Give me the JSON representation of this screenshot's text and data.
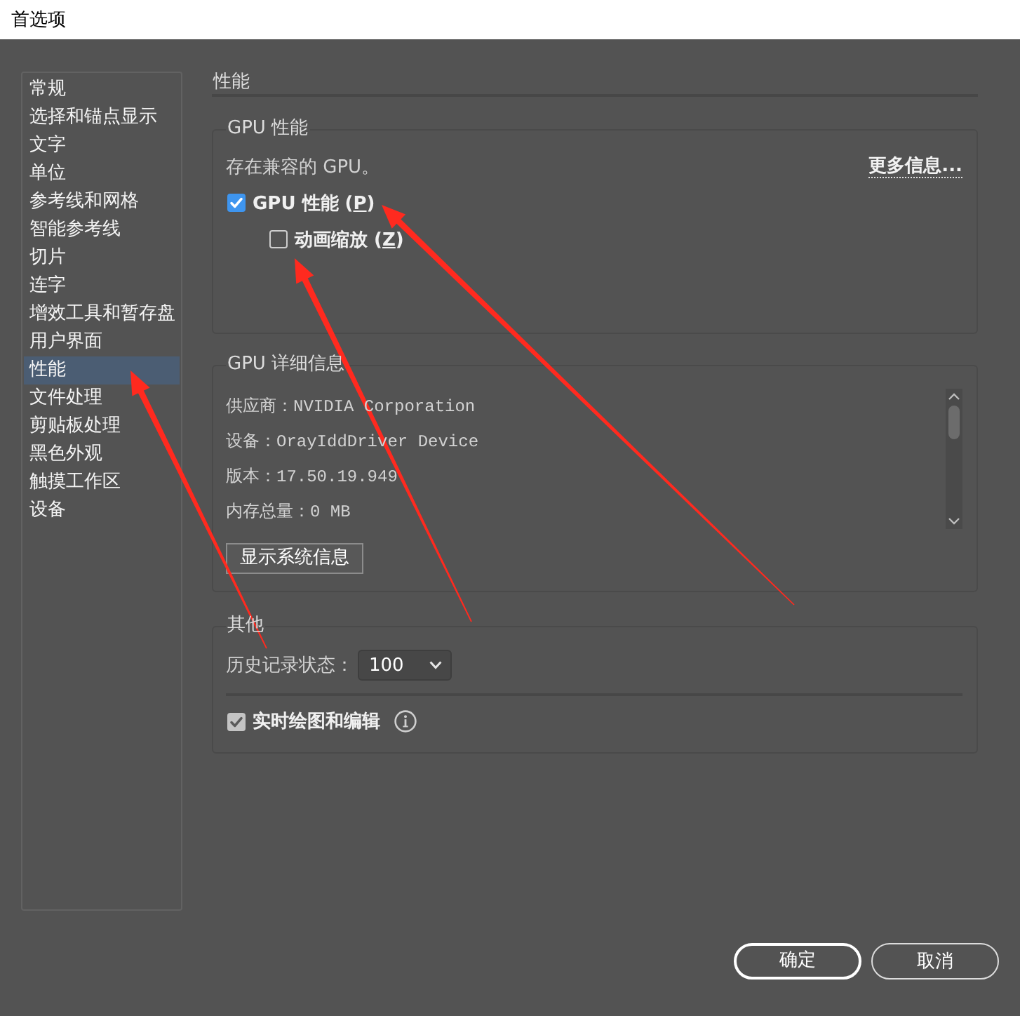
{
  "window": {
    "title": "首选项"
  },
  "sidebar": {
    "items": [
      {
        "label": "常规",
        "selected": false
      },
      {
        "label": "选择和锚点显示",
        "selected": false
      },
      {
        "label": "文字",
        "selected": false
      },
      {
        "label": "单位",
        "selected": false
      },
      {
        "label": "参考线和网格",
        "selected": false
      },
      {
        "label": "智能参考线",
        "selected": false
      },
      {
        "label": "切片",
        "selected": false
      },
      {
        "label": "连字",
        "selected": false
      },
      {
        "label": "增效工具和暂存盘",
        "selected": false
      },
      {
        "label": "用户界面",
        "selected": false
      },
      {
        "label": "性能",
        "selected": true
      },
      {
        "label": "文件处理",
        "selected": false
      },
      {
        "label": "剪贴板处理",
        "selected": false
      },
      {
        "label": "黑色外观",
        "selected": false
      },
      {
        "label": "触摸工作区",
        "selected": false
      },
      {
        "label": "设备",
        "selected": false
      }
    ]
  },
  "panel": {
    "heading": "性能",
    "gpu_performance": {
      "title": "GPU 性能",
      "status": "存在兼容的 GPU。",
      "more_info_link": "更多信息...",
      "checkboxes": [
        {
          "label_parts": [
            {
              "text": "GPU 性能 (",
              "underlined": false
            },
            {
              "text": "P",
              "underlined": true
            },
            {
              "text": ")",
              "underlined": false
            }
          ],
          "checked": true,
          "focused": true,
          "children": [
            {
              "label_parts": [
                {
                  "text": "动画缩放 (",
                  "underlined": false
                },
                {
                  "text": "Z",
                  "underlined": true
                },
                {
                  "text": ")",
                  "underlined": false
                }
              ],
              "checked": false,
              "focused": false
            }
          ]
        }
      ]
    },
    "gpu_details": {
      "title": "GPU 详细信息",
      "lines": [
        "供应商：NVIDIA Corporation",
        "设备：OrayIddDriver Device",
        "版本：17.50.19.949",
        "内存总量：0 MB"
      ],
      "button": "显示系统信息"
    },
    "other": {
      "title": "其他",
      "history_states": {
        "label": "历史记录状态：",
        "value": "100"
      },
      "checkboxes": [
        {
          "label_parts": [
            {
              "text": "实时绘图和编辑",
              "underlined": false
            }
          ],
          "checked": true,
          "focused": false
        }
      ]
    }
  },
  "buttons": [
    {
      "label": "确定",
      "default": true
    },
    {
      "label": "取消",
      "default": false
    }
  ],
  "annotations": [
    {
      "kind": "arrow"
    },
    {
      "kind": "arrow"
    },
    {
      "kind": "arrow"
    }
  ]
}
